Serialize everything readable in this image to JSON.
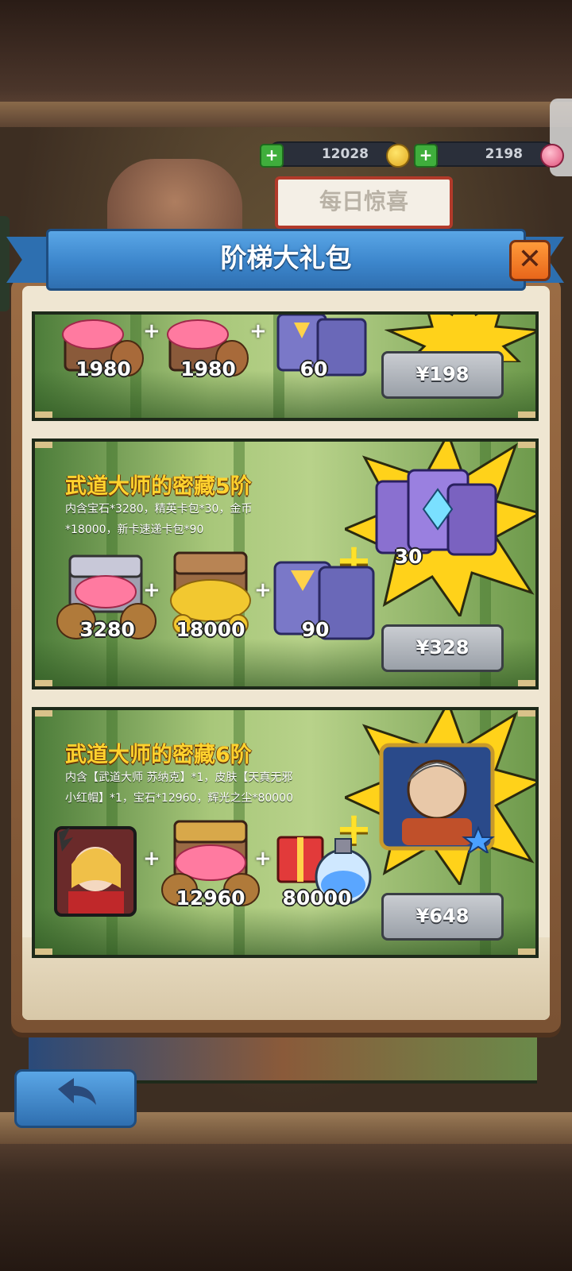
{
  "currency": {
    "coins": "12028",
    "gems": "2198",
    "plus": "+"
  },
  "daily_sign": "每日惊喜",
  "dialog": {
    "title": "阶梯大礼包",
    "close": "✕"
  },
  "packs": [
    {
      "title": "",
      "desc": "",
      "items": [
        {
          "name": "gems",
          "qty": "1980"
        },
        {
          "name": "gems",
          "qty": "1980"
        },
        {
          "name": "card-packs",
          "qty": "60"
        }
      ],
      "price": "¥198"
    },
    {
      "title": "武道大师的密藏5阶",
      "desc": "内含宝石*3280，精英卡包*30，金币*18000，新卡速递卡包*90",
      "items": [
        {
          "name": "gems",
          "qty": "3280"
        },
        {
          "name": "gold-coins",
          "qty": "18000"
        },
        {
          "name": "card-packs",
          "qty": "90"
        }
      ],
      "bonus_qty": "30",
      "price": "¥328"
    },
    {
      "title": "武道大师的密藏6阶",
      "desc": "内含【武道大师 苏纳克】*1，皮肤【天真无邪小红帽】*1，宝石*12960，辉光之尘*80000",
      "items": [
        {
          "name": "skin-portrait",
          "qty": ""
        },
        {
          "name": "gems",
          "qty": "12960"
        },
        {
          "name": "glow-dust",
          "qty": "80000"
        }
      ],
      "price": "¥648"
    }
  ],
  "plus_sign": "+",
  "back_icon": "back-arrow-icon",
  "colors": {
    "title_yellow": "#ffd22e",
    "ribbon_blue": "#3c86cc",
    "close_orange": "#ff9a3a",
    "price_grey": "#aeb3ba"
  }
}
